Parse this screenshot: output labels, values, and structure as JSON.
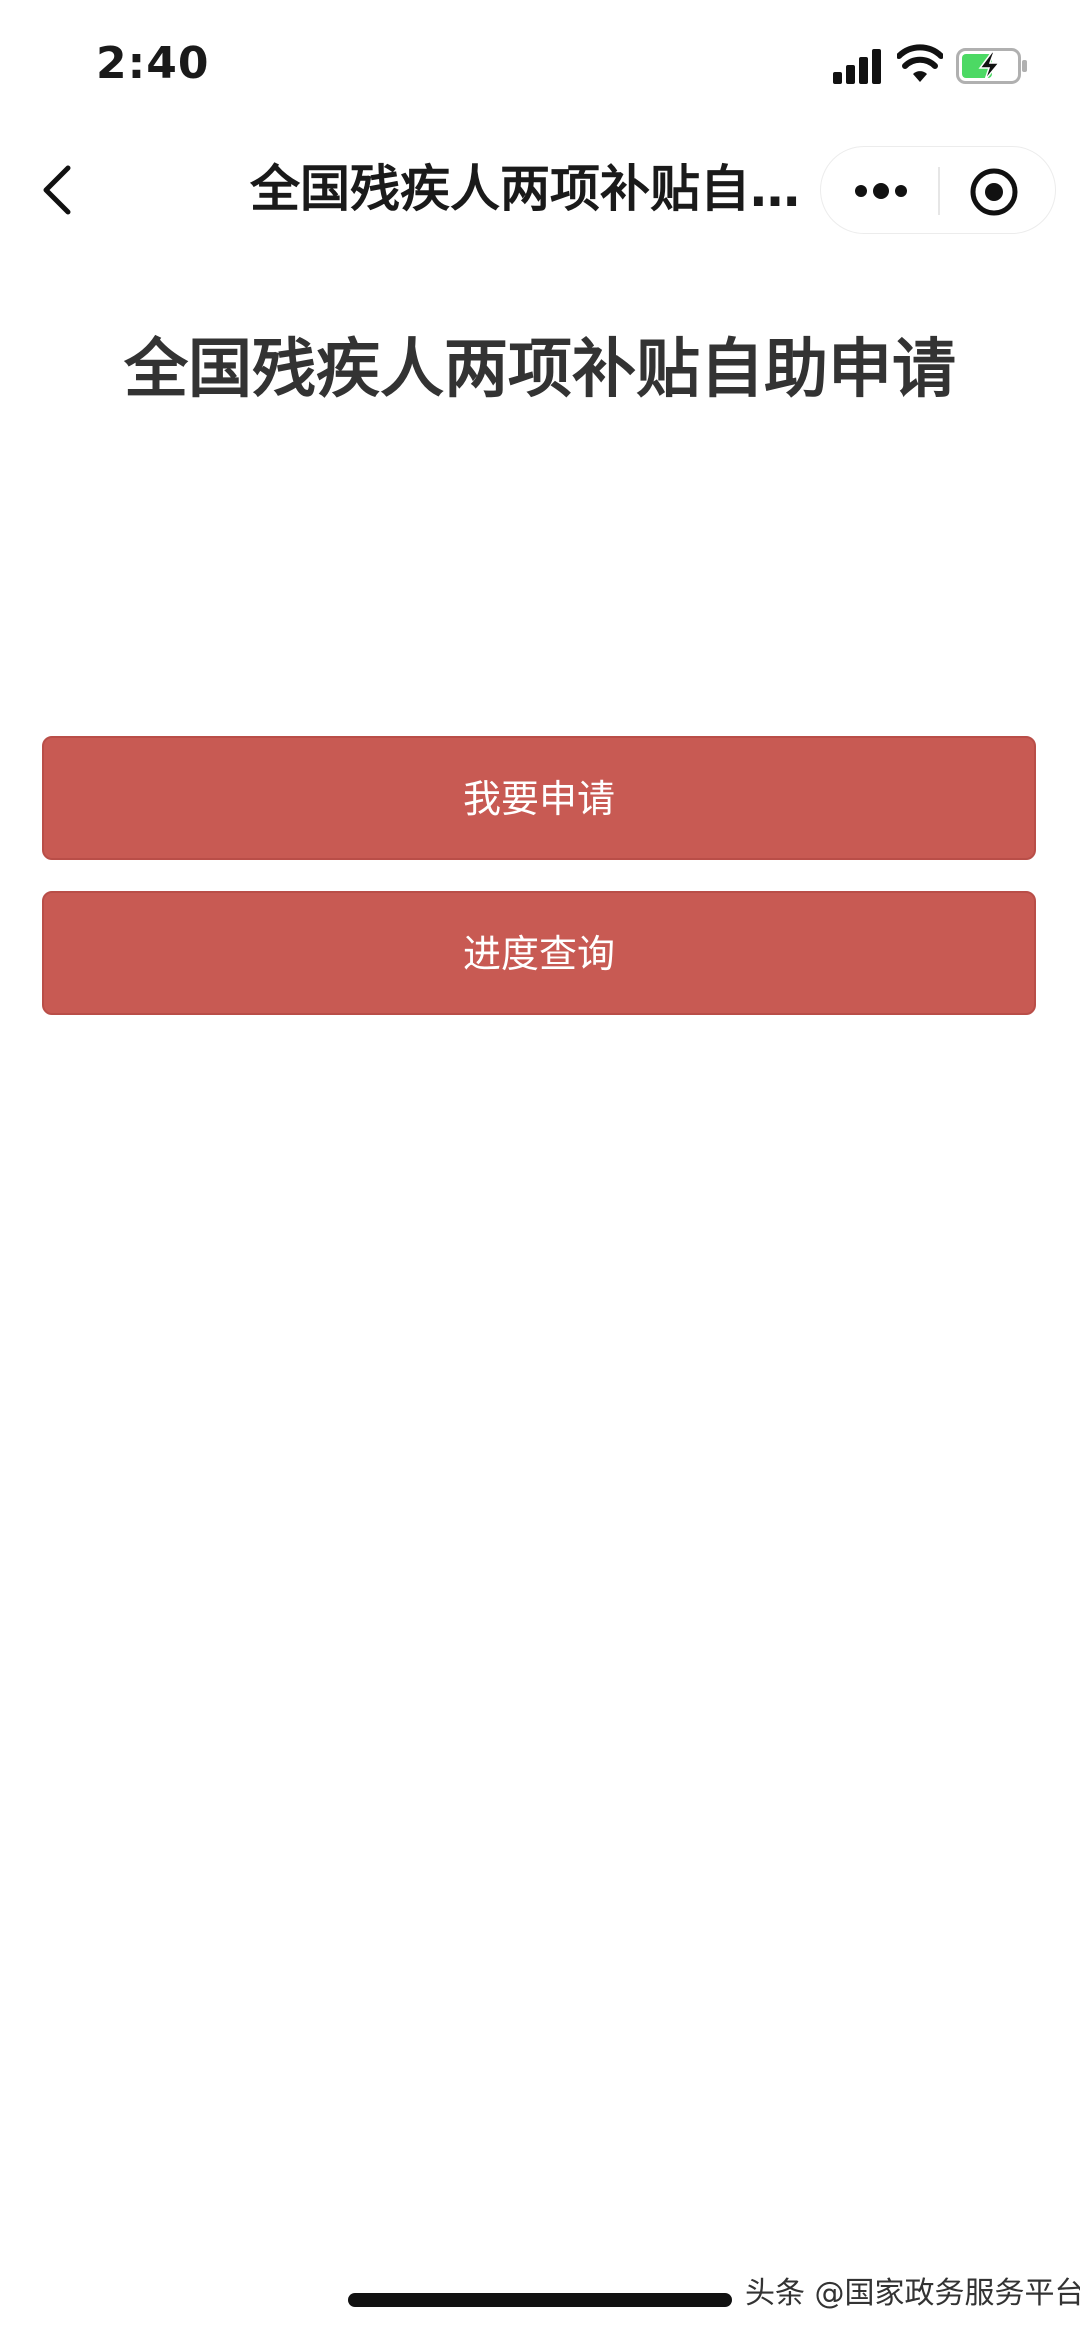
{
  "status_bar": {
    "time": "2:40",
    "icons": [
      "signal-icon",
      "wifi-icon",
      "battery-charging-icon"
    ],
    "battery_color": "#4cd964"
  },
  "nav_bar": {
    "title": "全国残疾人两项补贴自助申请",
    "icons": [
      "back-icon",
      "more-icon",
      "close-icon"
    ]
  },
  "main": {
    "title": "全国残疾人两项补贴自助申请",
    "buttons": [
      {
        "label": "我要申请",
        "color": "#c85a53"
      },
      {
        "label": "进度查询",
        "color": "#c85a53"
      }
    ]
  },
  "watermark": "头条 @国家政务服务平台"
}
